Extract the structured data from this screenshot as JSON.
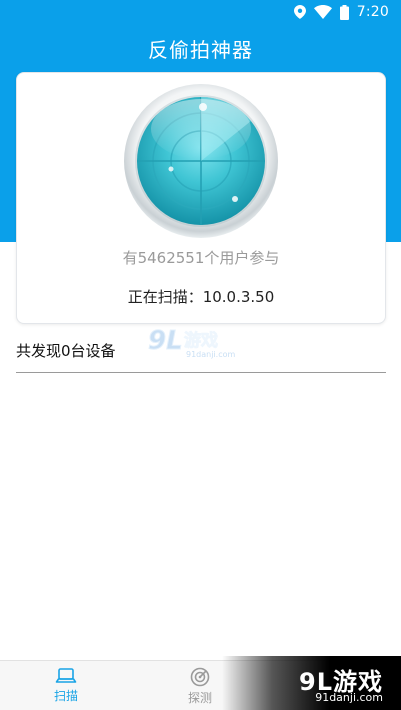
{
  "status_bar": {
    "time": "7:20",
    "icons": [
      "location-icon",
      "wifi-icon",
      "battery-icon"
    ]
  },
  "header": {
    "title": "反偷拍神器"
  },
  "scan_card": {
    "participants_text": "有5462551个用户参与",
    "scanning_text": "正在扫描：10.0.3.50"
  },
  "results": {
    "found_label": "共发现0台设备"
  },
  "tabs": [
    {
      "label": "扫描",
      "icon": "laptop-icon",
      "active": true
    },
    {
      "label": "探测",
      "icon": "radar-probe-icon",
      "active": false
    }
  ],
  "watermark": {
    "logo_text": "9L游戏",
    "url": "91danji.com"
  },
  "colors": {
    "primary_blue": "#0aa0ea",
    "active_tab": "#19a4e6",
    "radar_teal": "#3cc6d6"
  }
}
